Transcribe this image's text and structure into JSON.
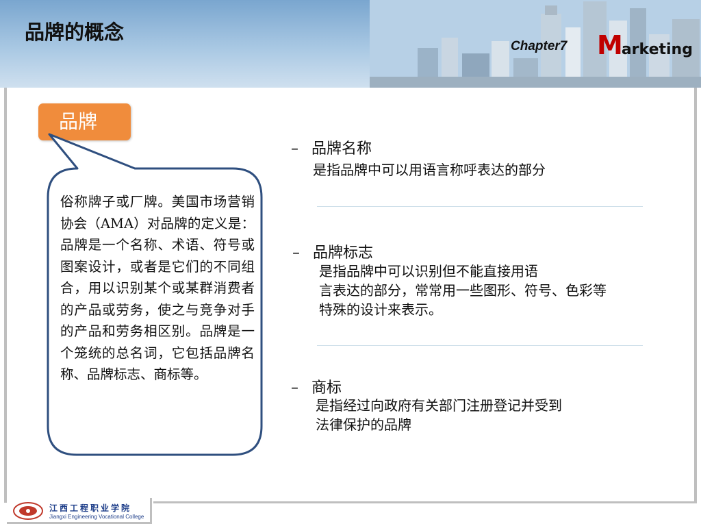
{
  "header": {
    "title": "品牌的概念",
    "chapter": "Chapter7",
    "marketing_first": "M",
    "marketing_rest": "arketing"
  },
  "tag": {
    "label": "品牌"
  },
  "bubble": {
    "text": "俗称牌子或厂牌。美国市场营销协会（AMA）对品牌的定义是：品牌是一个名称、术语、符号或图案设计，或者是它们的不同组合，用以识别某个或某群消费者的产品或劳务，使之与竞争对手的产品和劳务相区别。品牌是一个笼统的总名词，它包括品牌名称、品牌标志、商标等。"
  },
  "items": [
    {
      "dash": "–",
      "title": "品牌名称",
      "lines": [
        "是指品牌中可以用语言称呼表达的部分"
      ]
    },
    {
      "dash": "–",
      "title": "品牌标志",
      "lines": [
        "是指品牌中可以识别但不能直接用语",
        "言表达的部分，常常用一些图形、符号、色彩等",
        "特殊的设计来表示。"
      ]
    },
    {
      "dash": "–",
      "title": "商标",
      "lines": [
        "是指经过向政府有关部门注册登记并受到",
        "法律保护的品牌"
      ]
    }
  ],
  "footer": {
    "logo_cn": "江西工程职业学院",
    "logo_en": "Jiangxi Engineering Vocational College"
  },
  "colors": {
    "tag": "#f08c3c",
    "bubble_border": "#2f4f7f",
    "marketing_m": "#c00000",
    "logo_blue": "#1f3f8a"
  }
}
